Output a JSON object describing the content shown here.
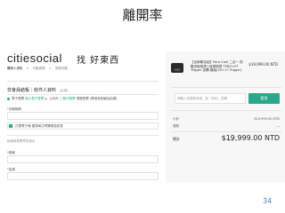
{
  "slide": {
    "title": "離開率",
    "page_number": "34"
  },
  "header": {
    "logo_text": "citiesocial",
    "tagline": "找 好東西",
    "breadcrumbs": [
      "購物人資料",
      ">",
      "付款資訊",
      ">",
      "完成付款"
    ]
  },
  "invoice": {
    "section_title": "非會員結帳｜收件人資料",
    "section_sub": "(必填)",
    "type_option_a": "電子發票",
    "type_option_b": "公司戶",
    "type_option_c": "捐贈發票",
    "radio_text_prefix": "個人電子發票",
    "radio_text_mid": "三聯式發票",
    "radio_text_suffix": "(需填寫統編及抬頭)",
    "field_label": "手機條碼",
    "checkbox_label": "訂閱電子報 獲得每日閃購優惠訊息",
    "tax_section_label": "統編與發票寄送地址",
    "tax_field_1_label": "統編",
    "tax_field_2_label": "抬頭"
  },
  "summary": {
    "product_name": "【全家聯名組】Para Cool 二合一 防曬涼爽噴霧+保濕噴霧 TPRO+ET Trigger 加購 套組(20+17 Trigger)",
    "product_price": "$19,999.00 NTD",
    "coupon_placeholder": "請輸入折價券序號，如「折扣」密碼",
    "apply_label": "套用",
    "subtotal_label": "小計",
    "subtotal_value": "$19,999.00 NTD",
    "shipping_label": "運費",
    "shipping_value": "—",
    "total_label": "總計",
    "total_currency": "TWD",
    "total_value": "$19,999.00 NTD"
  },
  "colors": {
    "accent": "#2aa88a",
    "page_number": "#4a7fc1"
  }
}
